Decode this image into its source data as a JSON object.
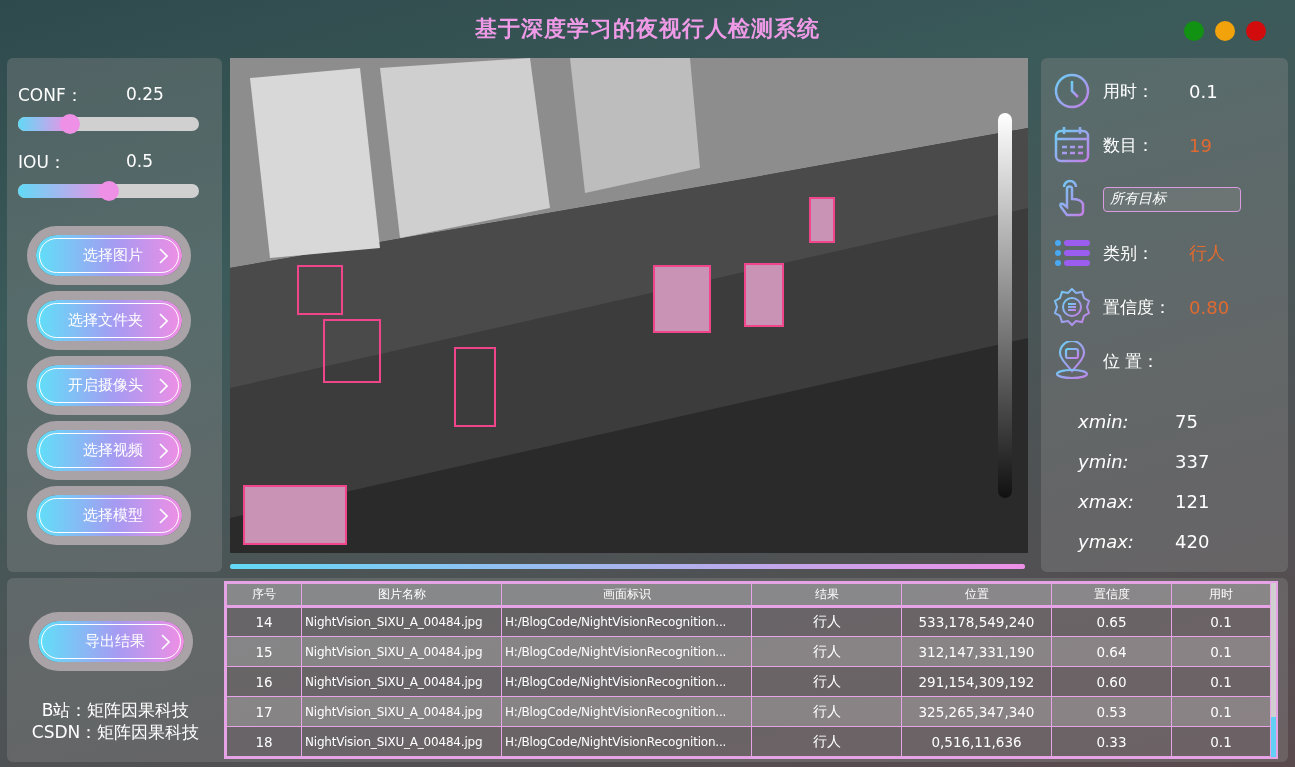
{
  "window": {
    "title": "基于深度学习的夜视行人检测系统"
  },
  "window_buttons": [
    {
      "color": "#129212"
    },
    {
      "color": "#f2a30c"
    },
    {
      "color": "#d20c0c"
    }
  ],
  "sliders": [
    {
      "label": "CONF：",
      "reading": "0.25",
      "level": 0.29
    },
    {
      "label": "IOU：",
      "reading": "0.5",
      "level": 0.5
    }
  ],
  "buttons": [
    "选择图片",
    "选择文件夹",
    "开启摄像头",
    "选择视频",
    "选择模型"
  ],
  "image": {
    "kind": "picture"
  },
  "progress": {
    "level": 1
  },
  "stats": [
    {
      "kind": "clock",
      "label": "用时：",
      "value": "0.1",
      "highlight": false
    },
    {
      "kind": "calendar",
      "label": "数目：",
      "value": "19",
      "highlight": true
    },
    {
      "kind": "select",
      "value": "所有目标"
    },
    {
      "kind": "list",
      "label": "类别：",
      "value": "行人",
      "highlight": true
    },
    {
      "kind": "gear",
      "label": "置信度：",
      "value": "0.80",
      "highlight": true
    },
    {
      "kind": "pin",
      "label": "位 置："
    }
  ],
  "coords": [
    {
      "label": "xmin:",
      "value": "75"
    },
    {
      "label": "ymin:",
      "value": "337"
    },
    {
      "label": "xmax:",
      "value": "121"
    },
    {
      "label": "ymax:",
      "value": "420"
    }
  ],
  "export_button": "导出结果",
  "credits": [
    "B站：矩阵因果科技",
    "CSDN：矩阵因果科技"
  ],
  "table": {
    "columns": [
      "序号",
      "图片名称",
      "画面标识",
      "结果",
      "位置",
      "置信度",
      "用时"
    ],
    "rows": [
      [
        "14",
        "NightVision_SIXU_A_00484.jpg",
        "H:/BlogCode/NightVisionRecognition...",
        "行人",
        "533,178,549,240",
        "0.65",
        "0.1"
      ],
      [
        "15",
        "NightVision_SIXU_A_00484.jpg",
        "H:/BlogCode/NightVisionRecognition...",
        "行人",
        "312,147,331,190",
        "0.64",
        "0.1"
      ],
      [
        "16",
        "NightVision_SIXU_A_00484.jpg",
        "H:/BlogCode/NightVisionRecognition...",
        "行人",
        "291,154,309,192",
        "0.60",
        "0.1"
      ],
      [
        "17",
        "NightVision_SIXU_A_00484.jpg",
        "H:/BlogCode/NightVisionRecognition...",
        "行人",
        "325,265,347,340",
        "0.53",
        "0.1"
      ],
      [
        "18",
        "NightVision_SIXU_A_00484.jpg",
        "H:/BlogCode/NightVisionRecognition...",
        "行人",
        "0,516,11,636",
        "0.33",
        "0.1"
      ]
    ]
  }
}
